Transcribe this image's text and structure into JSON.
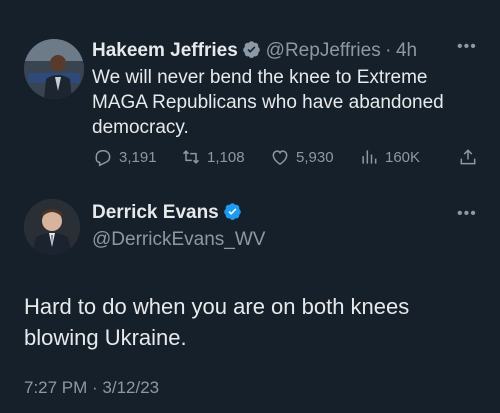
{
  "tweet1": {
    "author_name": "Hakeem Jeffries",
    "author_handle": "@RepJeffries",
    "separator": "·",
    "time": "4h",
    "more_icon": "more-icon",
    "text": "We will never bend the knee to Extreme MAGA Republicans who have abandoned democracy.",
    "actions": {
      "replies": "3,191",
      "retweets": "1,108",
      "likes": "5,930",
      "views": "160K"
    }
  },
  "tweet2": {
    "author_name": "Derrick Evans",
    "author_handle": "@DerrickEvans_WV",
    "more_icon": "more-icon",
    "text": "Hard to do when you are on both knees blowing Ukraine.",
    "timestamp": "7:27 PM · 3/12/23"
  },
  "colors": {
    "background": "#15202b",
    "text": "#e7e9ea",
    "muted": "#8b98a5",
    "verified": "#1d9bf0"
  }
}
